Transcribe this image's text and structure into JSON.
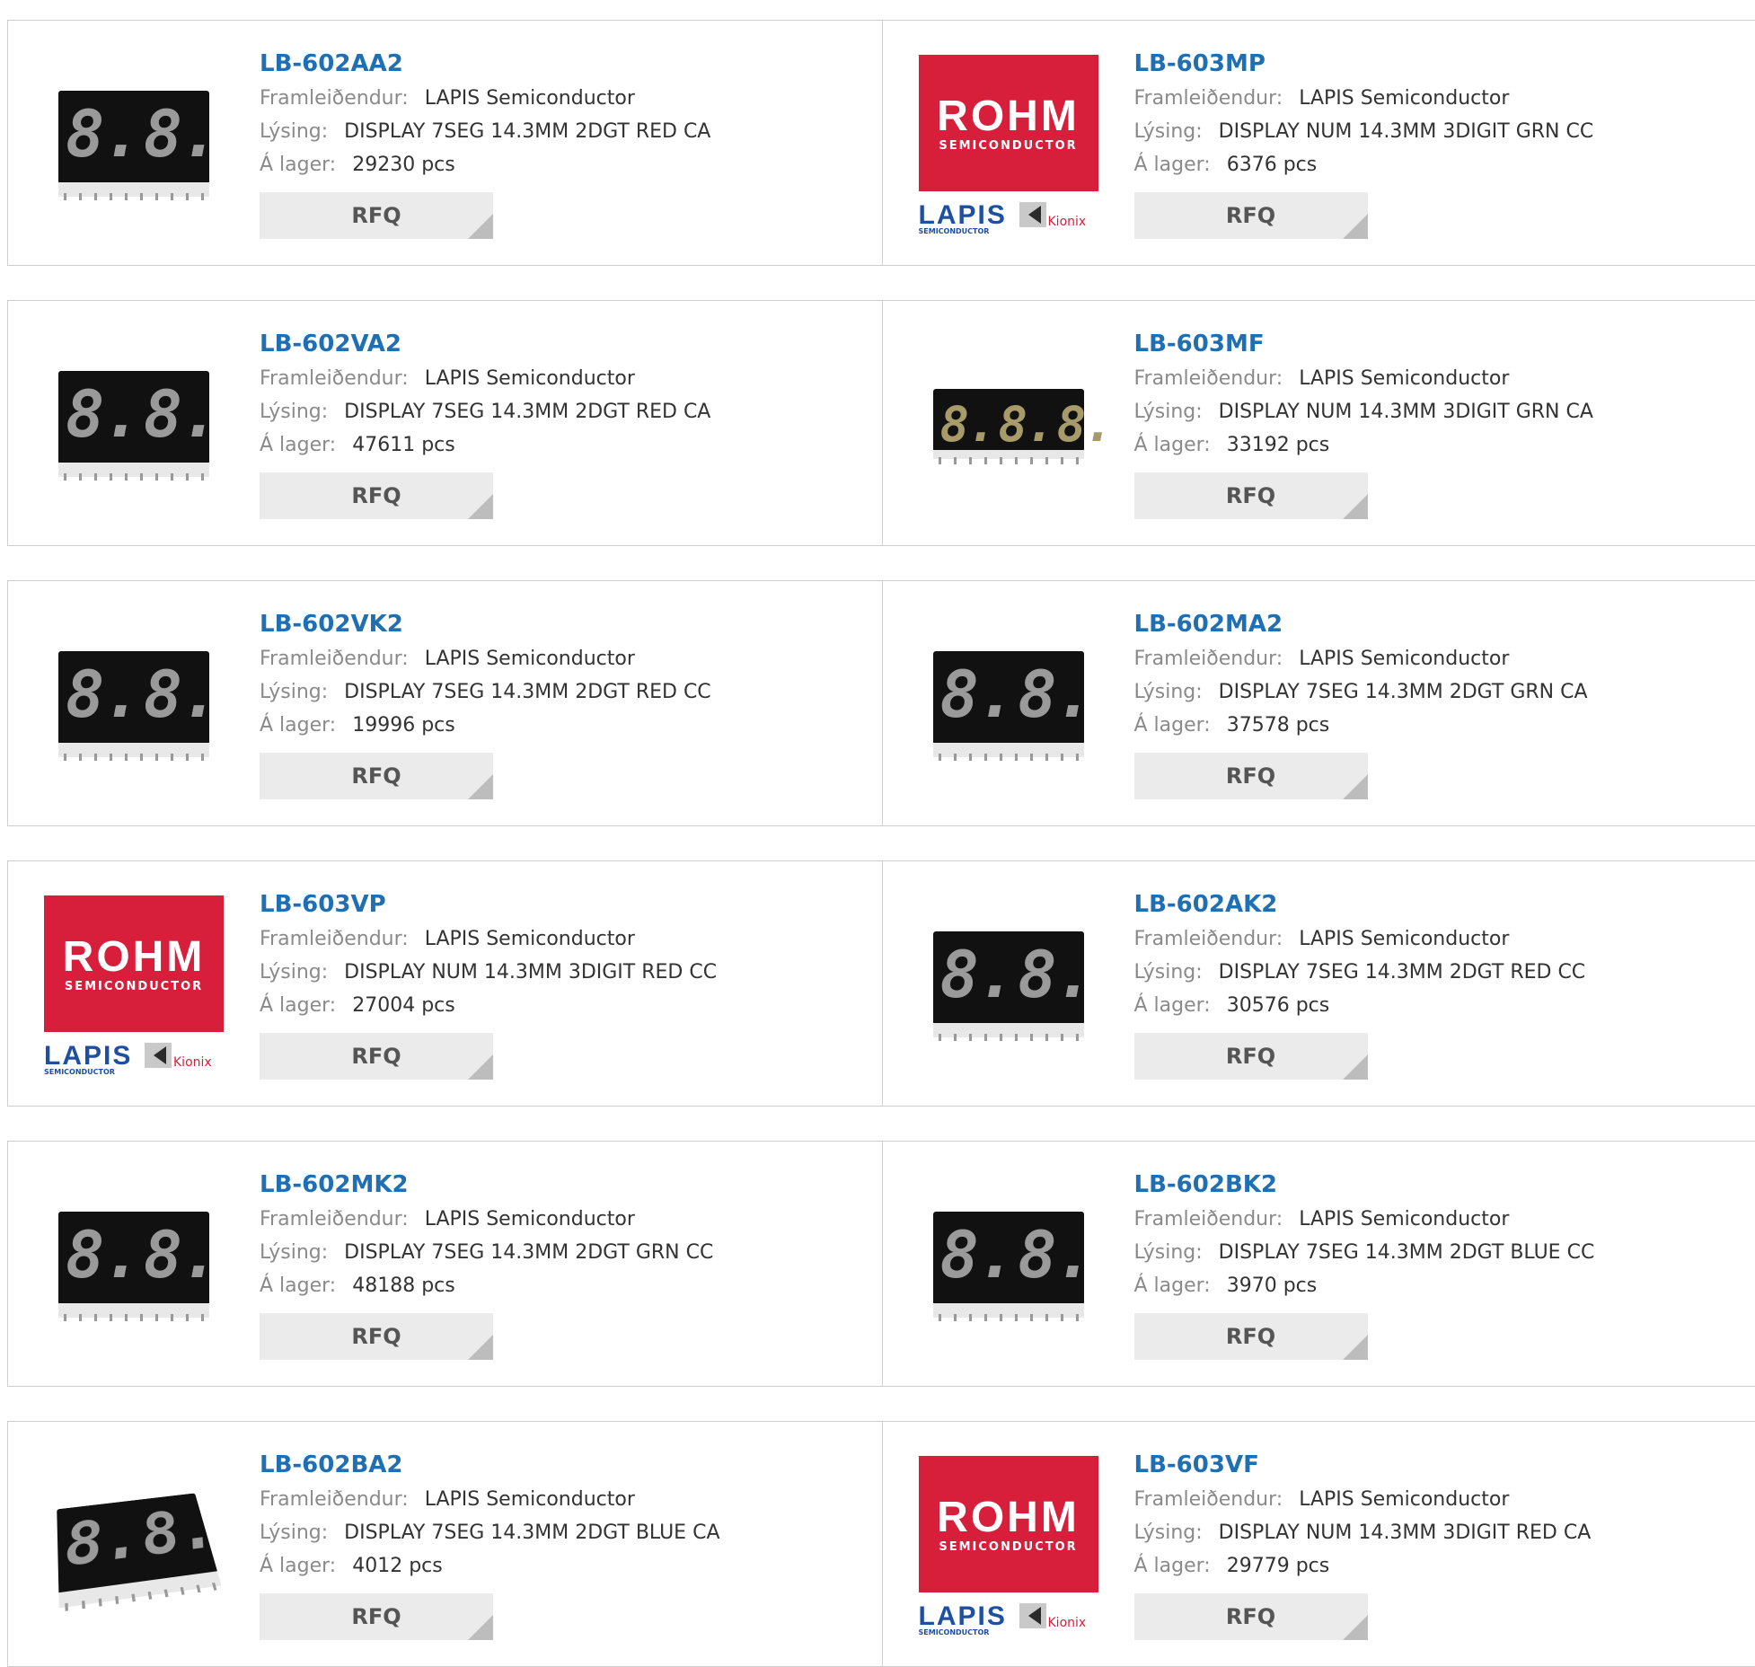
{
  "labels": {
    "manufacturer": "Framleiðendur:",
    "description": "Lýsing:",
    "stock": "Á lager:",
    "rfq": "RFQ"
  },
  "image_text": {
    "rohm": "ROHM",
    "semiconductor": "SEMICONDUCTOR",
    "lapis": "LAPIS",
    "lapis_sub": "SEMICONDUCTOR",
    "kionix": "Kionix",
    "two_digit": [
      "8.",
      "8."
    ],
    "three_digit": [
      "8.",
      "8.",
      "8."
    ]
  },
  "colors": {
    "title": "#1f6fb5",
    "rohm_red": "#d71f3c",
    "rfq_bg": "#ebebeb"
  },
  "products": [
    {
      "title": "LB-602AA2",
      "manufacturer": "LAPIS Semiconductor",
      "description": "DISPLAY 7SEG 14.3MM 2DGT RED CA",
      "stock": "29230 pcs",
      "image": "display-2digit"
    },
    {
      "title": "LB-603MP",
      "manufacturer": "LAPIS Semiconductor",
      "description": "DISPLAY NUM 14.3MM 3DIGIT GRN CC",
      "stock": "6376 pcs",
      "image": "rohm-logo"
    },
    {
      "title": "LB-602VA2",
      "manufacturer": "LAPIS Semiconductor",
      "description": "DISPLAY 7SEG 14.3MM 2DGT RED CA",
      "stock": "47611 pcs",
      "image": "display-2digit"
    },
    {
      "title": "LB-603MF",
      "manufacturer": "LAPIS Semiconductor",
      "description": "DISPLAY NUM 14.3MM 3DIGIT GRN CA",
      "stock": "33192 pcs",
      "image": "display-3digit"
    },
    {
      "title": "LB-602VK2",
      "manufacturer": "LAPIS Semiconductor",
      "description": "DISPLAY 7SEG 14.3MM 2DGT RED CC",
      "stock": "19996 pcs",
      "image": "display-2digit"
    },
    {
      "title": "LB-602MA2",
      "manufacturer": "LAPIS Semiconductor",
      "description": "DISPLAY 7SEG 14.3MM 2DGT GRN CA",
      "stock": "37578 pcs",
      "image": "display-2digit"
    },
    {
      "title": "LB-603VP",
      "manufacturer": "LAPIS Semiconductor",
      "description": "DISPLAY NUM 14.3MM 3DIGIT RED CC",
      "stock": "27004 pcs",
      "image": "rohm-logo"
    },
    {
      "title": "LB-602AK2",
      "manufacturer": "LAPIS Semiconductor",
      "description": "DISPLAY 7SEG 14.3MM 2DGT RED CC",
      "stock": "30576 pcs",
      "image": "display-2digit"
    },
    {
      "title": "LB-602MK2",
      "manufacturer": "LAPIS Semiconductor",
      "description": "DISPLAY 7SEG 14.3MM 2DGT GRN CC",
      "stock": "48188 pcs",
      "image": "display-2digit"
    },
    {
      "title": "LB-602BK2",
      "manufacturer": "LAPIS Semiconductor",
      "description": "DISPLAY 7SEG 14.3MM 2DGT BLUE CC",
      "stock": "3970 pcs",
      "image": "display-2digit"
    },
    {
      "title": "LB-602BA2",
      "manufacturer": "LAPIS Semiconductor",
      "description": "DISPLAY 7SEG 14.3MM 2DGT BLUE CA",
      "stock": "4012 pcs",
      "image": "display-angled"
    },
    {
      "title": "LB-603VF",
      "manufacturer": "LAPIS Semiconductor",
      "description": "DISPLAY NUM 14.3MM 3DIGIT RED CA",
      "stock": "29779 pcs",
      "image": "rohm-logo"
    }
  ]
}
